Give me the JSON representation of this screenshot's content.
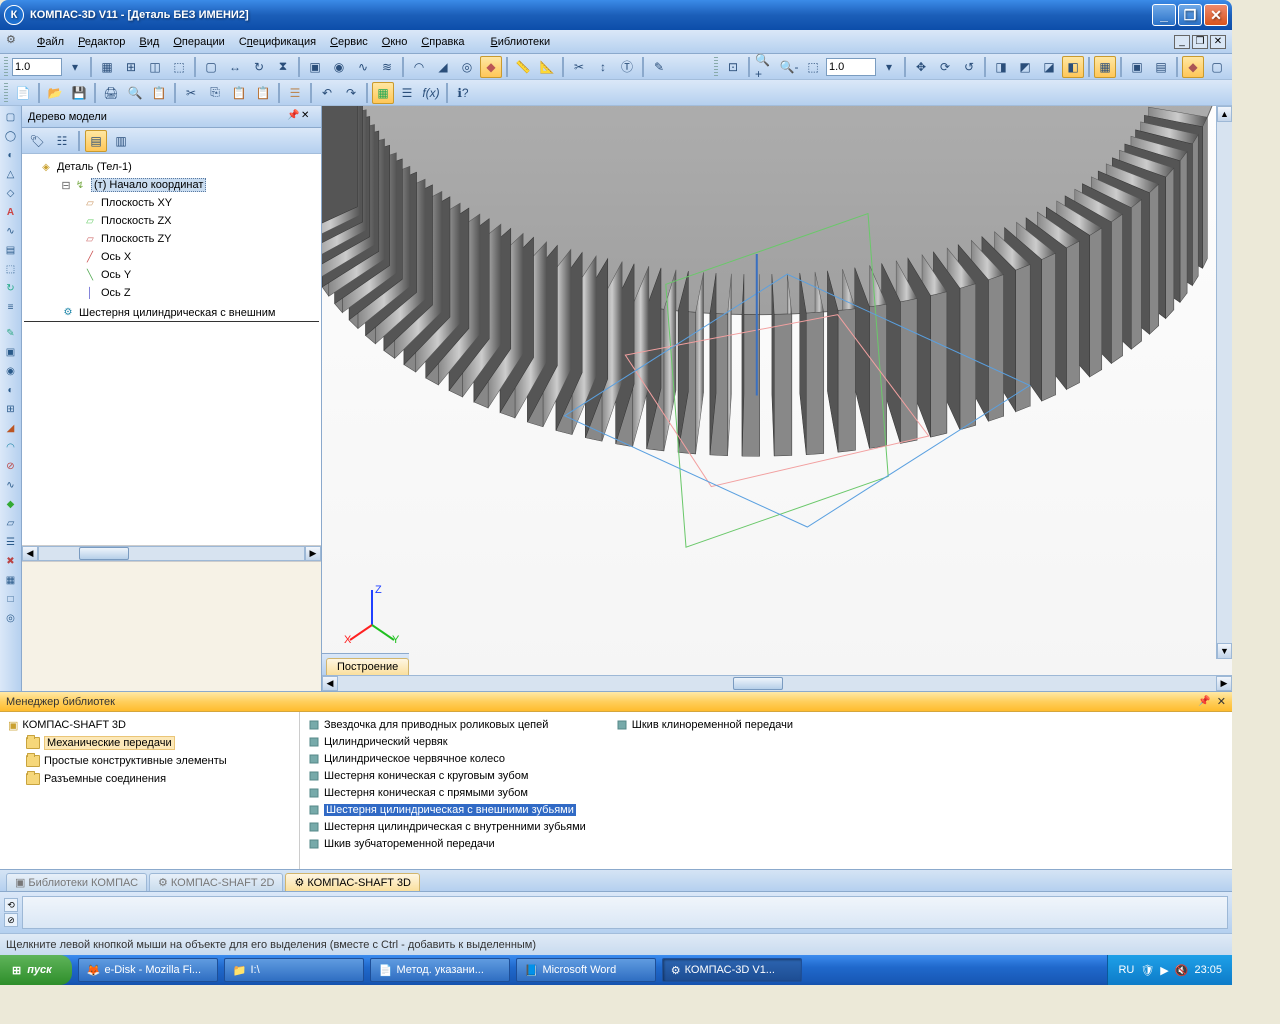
{
  "title": "КОМПАС-3D V11 - [Деталь БЕЗ ИМЕНИ2]",
  "menu": [
    "Файл",
    "Редактор",
    "Вид",
    "Операции",
    "Спецификация",
    "Сервис",
    "Окно",
    "Справка",
    "Библиотеки"
  ],
  "menu_ul": [
    "Ф",
    "Р",
    "В",
    "О",
    "п",
    "С",
    "О",
    "С",
    "Б"
  ],
  "toolbar1": {
    "zoom_value": "1.0"
  },
  "toolbar_right": {
    "zoom_value": "1.0"
  },
  "tree": {
    "title": "Дерево модели",
    "root": "Деталь (Тел-1)",
    "origin": "(т) Начало координат",
    "planes": [
      "Плоскость XY",
      "Плоскость ZX",
      "Плоскость ZY"
    ],
    "axes": [
      "Ось X",
      "Ось Y",
      "Ось Z"
    ],
    "feature": "Шестерня цилиндрическая с внешним"
  },
  "viewport_tab": "Построение",
  "libmgr": {
    "title": "Менеджер библиотек",
    "left_root": "КОМПАС-SHAFT 3D",
    "left_items": [
      "Механические передачи",
      "Простые конструктивные элементы",
      "Разъемные соединения"
    ],
    "right_col1": [
      "Звездочка для приводных роликовых цепей",
      "Цилиндрический червяк",
      "Цилиндрическое червячное колесо",
      "Шестерня коническая с круговым зубом",
      "Шестерня коническая с прямыми зубом",
      "Шестерня цилиндрическая с внешними зубьями",
      "Шестерня цилиндрическая с внутренними зубьями",
      "Шкив зубчатоременной передачи"
    ],
    "right_col2": [
      "Шкив клиноременной передачи"
    ],
    "selected_index": 5,
    "tabs": [
      "Библиотеки КОМПАС",
      "КОМПАС-SHAFT 2D",
      "КОМПАС-SHAFT 3D"
    ],
    "active_tab": 2
  },
  "status": "Щелкните левой кнопкой мыши на объекте для его выделения (вместе с Ctrl - добавить к выделенным)",
  "taskbar": {
    "start": "пуск",
    "tasks": [
      "e-Disk - Mozilla Fi...",
      "I:\\",
      "Метод. указани...",
      "Microsoft Word",
      "КОМПАС-3D V1..."
    ],
    "active_task": 4,
    "lang": "RU",
    "time": "23:05"
  },
  "axes": {
    "x": "X",
    "y": "Y",
    "z": "Z"
  }
}
